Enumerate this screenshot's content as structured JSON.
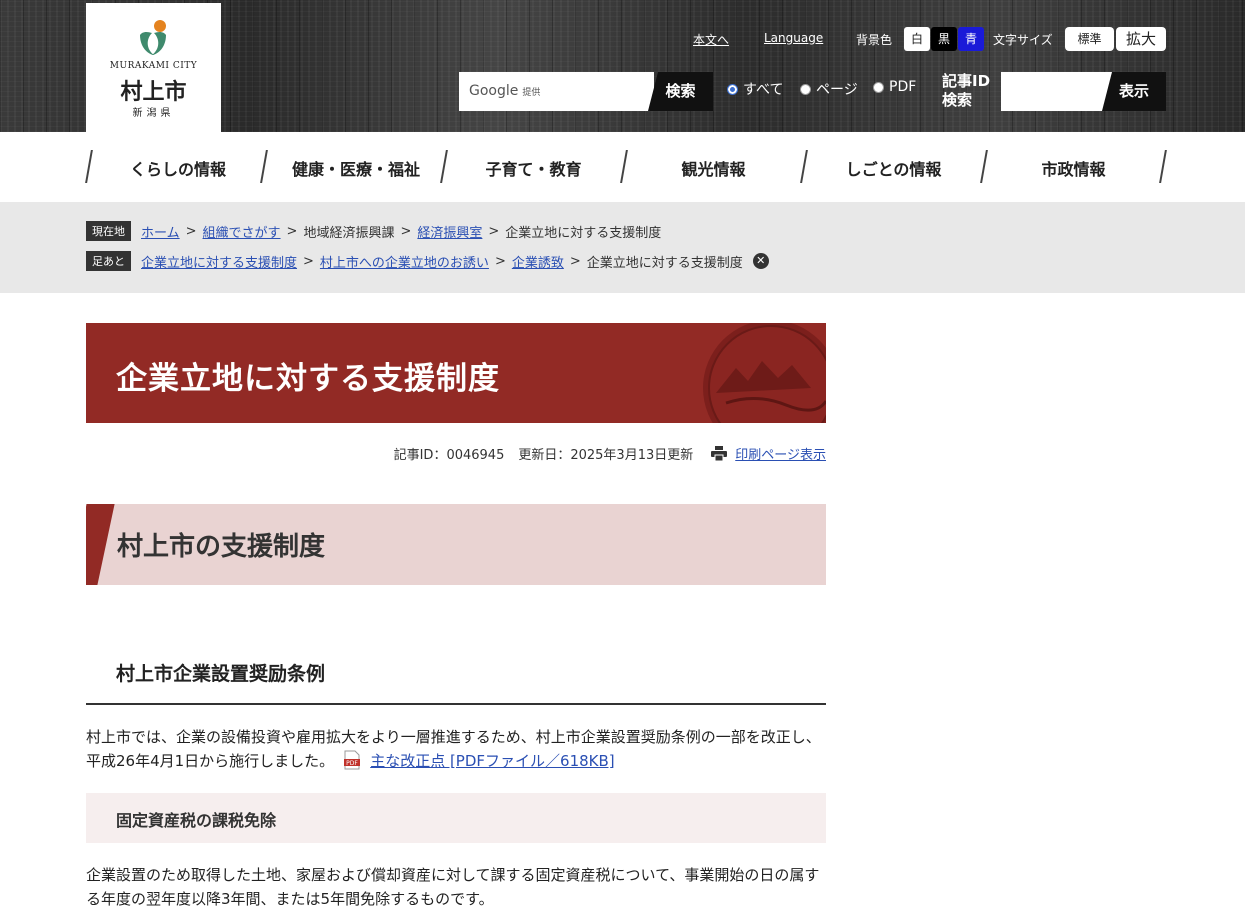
{
  "header": {
    "logo_en": "MURAKAMI CITY",
    "logo_jp": "村上市",
    "logo_pref": "新潟県",
    "skip_link": "本文へ",
    "language_link": "Language",
    "bg_color_label": "背景色",
    "bg_white": "白",
    "bg_black": "黒",
    "bg_blue": "青",
    "font_size_label": "文字サイズ",
    "font_standard": "標準",
    "font_large": "拡大",
    "search_google": "Google",
    "search_provided": "提供",
    "search_button": "検索",
    "radio_all": "すべて",
    "radio_page": "ページ",
    "radio_pdf": "PDF",
    "article_id_label_1": "記事ID",
    "article_id_label_2": "検索",
    "article_id_button": "表示"
  },
  "nav": {
    "items": [
      {
        "label": "くらしの情報"
      },
      {
        "label": "健康・医療・福祉"
      },
      {
        "label": "子育て・教育"
      },
      {
        "label": "観光情報"
      },
      {
        "label": "しごとの情報"
      },
      {
        "label": "市政情報"
      }
    ]
  },
  "breadcrumb": {
    "current_tag": "現在地",
    "current": [
      "ホーム",
      "組織でさがす",
      "地域経済振興課",
      "経済振興室",
      "企業立地に対する支援制度"
    ],
    "history_tag": "足あと",
    "history": [
      "企業立地に対する支援制度",
      "村上市への企業立地のお誘い",
      "企業誘致",
      "企業立地に対する支援制度"
    ]
  },
  "page": {
    "title": "企業立地に対する支援制度",
    "article_id": "記事ID：0046945",
    "updated": "更新日：2025年3月13日更新",
    "print_link": "印刷ページ表示",
    "section_h2": "村上市の支援制度",
    "section_h3": "村上市企業設置奨励条例",
    "para1": "村上市では、企業の設備投資や雇用拡大をより一層推進するため、村上市企業設置奨励条例の一部を改正し、平成26年4月1日から施行しました。",
    "pdf_link": "主な改正点 [PDFファイル／618KB]",
    "section_h4": "固定資産税の課税免除",
    "para2": "企業設置のため取得した土地、家屋および償却資産に対して課する固定資産税について、事業開始の日の属する年度の翌年度以降3年間、または5年間免除するものです。"
  },
  "colors": {
    "brand_red": "#922a25",
    "link_blue": "#2a4fb3",
    "h2_bg": "#e9d3d2",
    "bg_blue_btn": "#1a1ad8"
  }
}
